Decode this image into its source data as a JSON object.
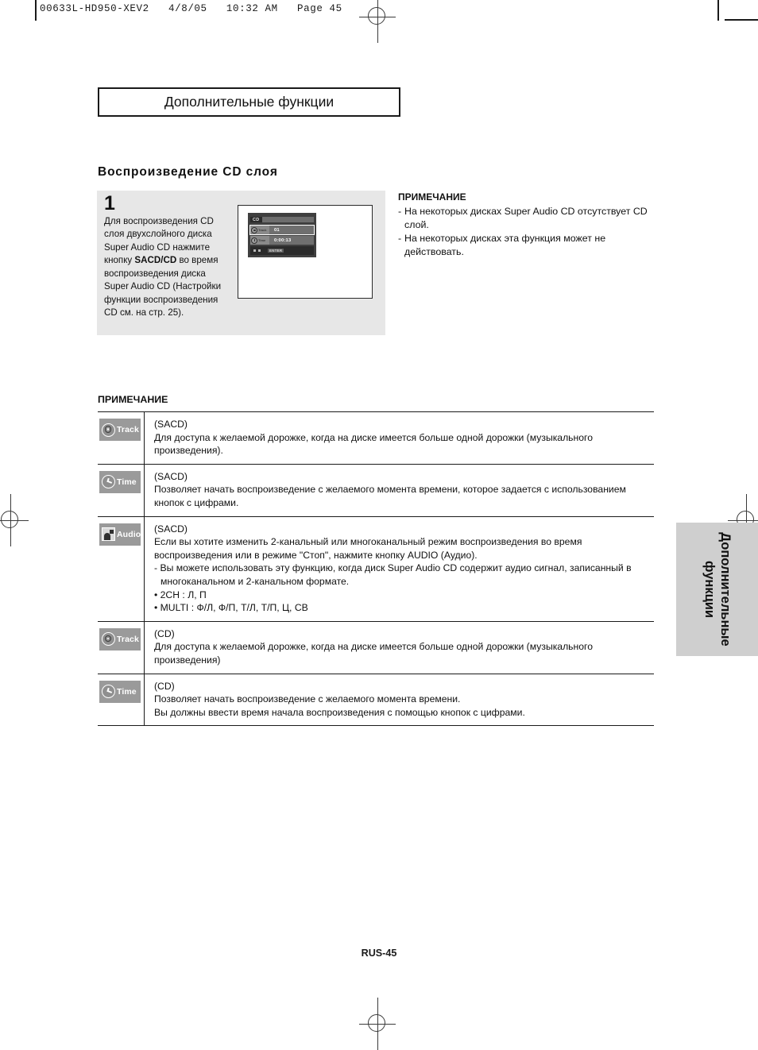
{
  "print_header": "00633L-HD950-XEV2   4/8/05   10:32 AM   Page 45",
  "title_box": {
    "text": "Дополнительные функции"
  },
  "section_heading": "Воспроизведение CD слоя",
  "side_tab": {
    "text": "Дополнительные функции"
  },
  "step": {
    "number": "1",
    "text_before_bold": "Для воспроизведения CD слоя двухслойного диска Super Audio CD нажмите кнопку ",
    "bold": "SACD/CD",
    "text_after_bold": " во время воспроизведения диска Super Audio CD (Настройки функции воспроизведения CD см. на стр. 25)."
  },
  "osd": {
    "title": "CD",
    "track_label": "Track",
    "track_value": "01",
    "time_label": "Time",
    "time_value": "0:00:13",
    "enter_label": "ENTER"
  },
  "note_right": {
    "title": "ПРИМЕЧАНИЕ",
    "items": [
      "На некоторых дисках Super Audio CD отсутствует CD слой.",
      "На некоторых дисках эта функция может не действовать."
    ],
    "dash": "-"
  },
  "note_table": {
    "label": "ПРИМЕЧАНИЕ",
    "rows": [
      {
        "icon": "track-icon",
        "badge_label": "Track",
        "lines": [
          {
            "text": "(SACD)",
            "style": "plain"
          },
          {
            "text": "Для доступа к желаемой дорожке, когда на диске имеется больше одной дорожки (музыкального произведения).",
            "style": "plain"
          }
        ]
      },
      {
        "icon": "time-icon",
        "badge_label": "Time",
        "lines": [
          {
            "text": "(SACD)",
            "style": "plain"
          },
          {
            "text": " Позволяет начать воспроизведение с желаемого момента времени, которое задается с использованием кнопок с цифрами.",
            "style": "plain"
          }
        ]
      },
      {
        "icon": "audio-icon",
        "badge_label": "Audio",
        "lines": [
          {
            "text": "(SACD)",
            "style": "plain"
          },
          {
            "text": "Если вы хотите изменить 2-канальный или многоканальный режим воспроизведения во время воспроизведения или в режиме \"Стоп\", нажмите кнопку AUDIO (Аудио).",
            "style": "plain"
          },
          {
            "text": "- Вы можете использовать эту функцию, когда диск Super Audio CD содержит аудио сигнал, записанный в многоканальном и 2-канальном формате.",
            "style": "indent"
          },
          {
            "text": "• 2CH : Л, П",
            "style": "plain"
          },
          {
            "text": "• MULTI : Ф/Л, Ф/П, Т/Л, Т/П, Ц, СВ",
            "style": "plain"
          }
        ]
      },
      {
        "icon": "track-icon",
        "badge_label": "Track",
        "lines": [
          {
            "text": "(CD)",
            "style": "plain"
          },
          {
            "text": "Для доступа к желаемой дорожке, когда на диске имеется больше одной дорожки (музыкального произведения)",
            "style": "plain"
          }
        ]
      },
      {
        "icon": "time-icon",
        "badge_label": "Time",
        "lines": [
          {
            "text": "(CD)",
            "style": "plain"
          },
          {
            "text": "Позволяет начать воспроизведение с желаемого момента времени.",
            "style": "plain"
          },
          {
            "text": "Вы должны ввести время начала воспроизведения с помощью кнопок с цифрами.",
            "style": "plain"
          }
        ]
      }
    ]
  },
  "footer": "RUS-45"
}
